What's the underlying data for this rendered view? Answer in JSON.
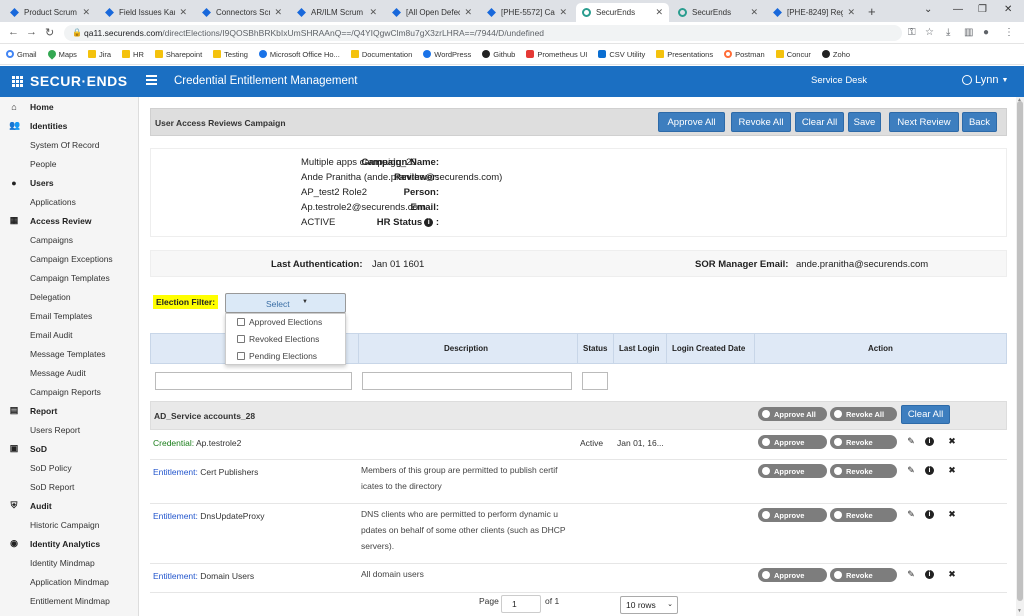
{
  "browser": {
    "tabs": [
      {
        "label": "Product Scrum B...",
        "icon": "jira"
      },
      {
        "label": "Field Issues Kanb...",
        "icon": "jira"
      },
      {
        "label": "Connectors Scru...",
        "icon": "jira"
      },
      {
        "label": "AR/ILM Scrum B...",
        "icon": "jira"
      },
      {
        "label": "[All Open Defect...",
        "icon": "jira"
      },
      {
        "label": "[PHE-5572] Camp...",
        "icon": "jira"
      },
      {
        "label": "SecurEnds",
        "icon": "securends",
        "active": true
      },
      {
        "label": "SecurEnds",
        "icon": "securends"
      },
      {
        "label": "[PHE-8249] Regr...",
        "icon": "jira"
      }
    ],
    "new_tab": "+",
    "url_host": "qa11.securends.com",
    "url_path": "/directElections/I9QOSBhBRKbIxUmSHRAAnQ==/Q4YIQgwClm8u7gX3zrLHRA==/7944/D/undefined",
    "bookmarks": [
      {
        "label": "Gmail",
        "icon": "g"
      },
      {
        "label": "Maps",
        "icon": "pin"
      },
      {
        "label": "Jira",
        "icon": "folder"
      },
      {
        "label": "HR",
        "icon": "folder"
      },
      {
        "label": "Sharepoint",
        "icon": "folder"
      },
      {
        "label": "Testing",
        "icon": "folder"
      },
      {
        "label": "Microsoft Office Ho...",
        "icon": "blue"
      },
      {
        "label": "Documentation",
        "icon": "folder"
      },
      {
        "label": "WordPress",
        "icon": "blue"
      },
      {
        "label": "Github",
        "icon": "dark"
      },
      {
        "label": "Prometheus UI",
        "icon": "red"
      },
      {
        "label": "CSV Utility",
        "icon": "cc"
      },
      {
        "label": "Presentations",
        "icon": "folder"
      },
      {
        "label": "Postman",
        "icon": "org"
      },
      {
        "label": "Concur",
        "icon": "folder"
      },
      {
        "label": "Zoho",
        "icon": "dark"
      }
    ]
  },
  "app": {
    "logo": "SECUR·ENDS",
    "title": "Credential Entitlement Management",
    "service_desk": "Service Desk",
    "user": "Lynn"
  },
  "sidebar": [
    {
      "label": "Home",
      "main": true,
      "icon": "⌂"
    },
    {
      "label": "Identities",
      "main": true,
      "icon": "👥"
    },
    {
      "label": "System Of Record"
    },
    {
      "label": "People"
    },
    {
      "label": "Users",
      "main": true,
      "icon": "●"
    },
    {
      "label": "Applications"
    },
    {
      "label": "Access Review",
      "main": true,
      "icon": "▦"
    },
    {
      "label": "Campaigns"
    },
    {
      "label": "Campaign Exceptions"
    },
    {
      "label": "Campaign Templates"
    },
    {
      "label": "Delegation"
    },
    {
      "label": "Email Templates"
    },
    {
      "label": "Email Audit"
    },
    {
      "label": "Message Templates"
    },
    {
      "label": "Message Audit"
    },
    {
      "label": "Campaign Reports"
    },
    {
      "label": "Report",
      "main": true,
      "icon": "▤"
    },
    {
      "label": "Users Report"
    },
    {
      "label": "SoD",
      "main": true,
      "icon": "▣"
    },
    {
      "label": "SoD Policy"
    },
    {
      "label": "SoD Report"
    },
    {
      "label": "Audit",
      "main": true,
      "icon": "⛨"
    },
    {
      "label": "Historic Campaign"
    },
    {
      "label": "Identity Analytics",
      "main": true,
      "icon": "◉"
    },
    {
      "label": "Identity Mindmap"
    },
    {
      "label": "Application Mindmap"
    },
    {
      "label": "Entitlement Mindmap"
    }
  ],
  "campaign_header": {
    "title": "User Access Reviews Campaign",
    "buttons": [
      "Approve All",
      "Revoke All",
      "Clear All",
      "Save",
      "Next Review",
      "Back"
    ]
  },
  "info": {
    "campaign_name_label": "Campaign Name:",
    "campaign_name": "Multiple apps campaign_29",
    "reviewer_label": "Reviewer:",
    "reviewer": "Ande Pranitha (ande.pranitha@securends.com)",
    "person_label": "Person:",
    "person": "AP_test2 Role2",
    "email_label": "Email:",
    "email": "Ap.testrole2@securends.com",
    "hr_status_label": "HR Status",
    "hr_status": "ACTIVE"
  },
  "auth": {
    "last_auth_label": "Last Authentication:",
    "last_auth": "Jan 01 1601",
    "sor_label": "SOR Manager Email:",
    "sor": "ande.pranitha@securends.com"
  },
  "election_filter": {
    "label": "Election Filter:",
    "select": "Select",
    "options": [
      "Approved Elections",
      "Revoked Elections",
      "Pending Elections"
    ]
  },
  "table": {
    "columns": [
      "Description",
      "Status",
      "Last Login",
      "Login Created Date",
      "Action"
    ],
    "group": "AD_Service accounts_28",
    "group_buttons": {
      "approve_all": "Approve All",
      "revoke_all": "Revoke All",
      "clear_all": "Clear All"
    },
    "approve": "Approve",
    "revoke": "Revoke",
    "rows": [
      {
        "type": "Credential:",
        "name": "Ap.testrole2",
        "desc": [
          "",
          "",
          ""
        ],
        "status": "Active",
        "last_login": "Jan 01, 16..."
      },
      {
        "type": "Entitlement:",
        "name": "Cert Publishers",
        "desc": [
          "Members of this group are permitted to publish certif",
          "icates to the directory",
          ""
        ],
        "status": "",
        "last_login": ""
      },
      {
        "type": "Entitlement:",
        "name": "DnsUpdateProxy",
        "desc": [
          "DNS clients who are permitted to perform dynamic u",
          "pdates on behalf of some other clients (such as DHCP",
          "servers)."
        ],
        "status": "",
        "last_login": ""
      },
      {
        "type": "Entitlement:",
        "name": "Domain Users",
        "desc": [
          "All domain users",
          "",
          ""
        ],
        "status": "",
        "last_login": ""
      }
    ]
  },
  "pager": {
    "page_label": "Page",
    "page": "1",
    "of": "of 1",
    "rows": "10 rows"
  }
}
